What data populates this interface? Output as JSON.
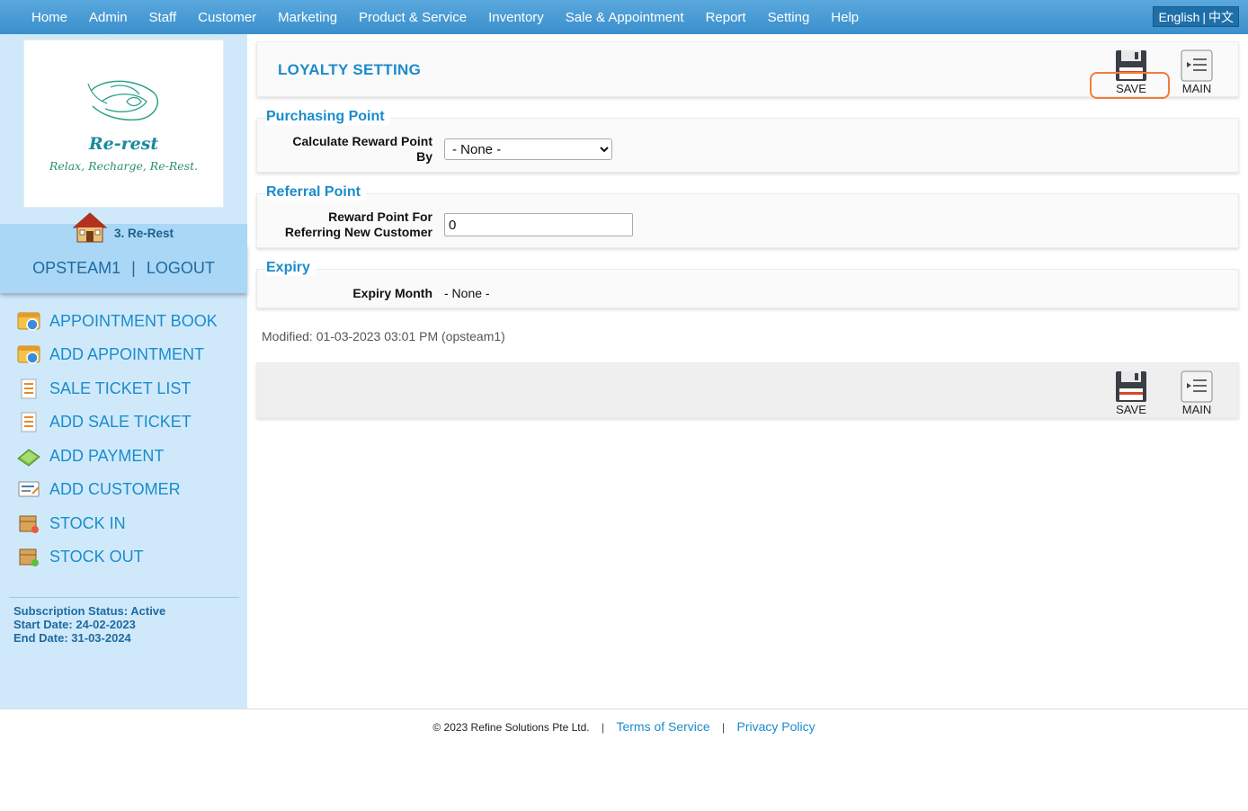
{
  "nav": {
    "items": [
      "Home",
      "Admin",
      "Staff",
      "Customer",
      "Marketing",
      "Product & Service",
      "Inventory",
      "Sale & Appointment",
      "Report",
      "Setting",
      "Help"
    ],
    "lang_en": "English",
    "lang_sep": "|",
    "lang_zh": "中文"
  },
  "sidebar": {
    "logo_title": "Re-rest",
    "logo_tagline": "Relax, Recharge, Re-Rest.",
    "branch": "3. Re-Rest",
    "user": "OPSTEAM1",
    "user_sep": "|",
    "logout": "LOGOUT",
    "quick_items": [
      {
        "label": "APPOINTMENT BOOK",
        "icon": "appointment-book-icon"
      },
      {
        "label": "ADD APPOINTMENT",
        "icon": "add-appointment-icon"
      },
      {
        "label": "SALE TICKET LIST",
        "icon": "sale-ticket-list-icon"
      },
      {
        "label": "ADD SALE TICKET",
        "icon": "add-sale-ticket-icon"
      },
      {
        "label": "ADD PAYMENT",
        "icon": "add-payment-icon"
      },
      {
        "label": "ADD CUSTOMER",
        "icon": "add-customer-icon"
      },
      {
        "label": "STOCK IN",
        "icon": "stock-in-icon"
      },
      {
        "label": "STOCK OUT",
        "icon": "stock-out-icon"
      }
    ],
    "subscription_status": "Subscription Status: Active",
    "start_date": "Start Date: 24-02-2023",
    "end_date": "End Date: 31-03-2024"
  },
  "main": {
    "title": "LOYALTY SETTING",
    "save_label": "SAVE",
    "main_label": "MAIN",
    "purchasing": {
      "title": "Purchasing Point",
      "label_line1": "Calculate Reward Point",
      "label_line2": "By",
      "selected": "- None -"
    },
    "referral": {
      "title": "Referral Point",
      "label_line1": "Reward Point For",
      "label_line2": "Referring New Customer",
      "value": "0"
    },
    "expiry": {
      "title": "Expiry",
      "label": "Expiry Month",
      "value": "- None -"
    },
    "modified": "Modified: 01-03-2023 03:01 PM (opsteam1)"
  },
  "footer": {
    "copyright": "© 2023 Refine Solutions Pte Ltd.",
    "sep": "|",
    "terms": "Terms of Service",
    "privacy": "Privacy Policy"
  },
  "colors": {
    "accent": "#1b8ccb",
    "nav_bg": "#4a9dd6",
    "sidebar_bg": "#cfe9fb",
    "highlight": "#f47b3c"
  }
}
